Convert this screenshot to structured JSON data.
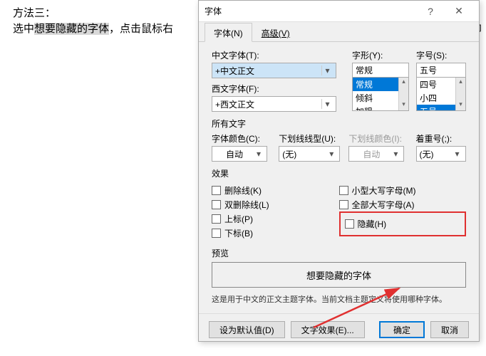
{
  "bg": {
    "line1": "方法三：",
    "line2_pre": "选中",
    "line2_hl": "想要隐藏的字体",
    "line2_post": "，点击鼠标右",
    "right": "能即"
  },
  "dialog": {
    "title": "字体",
    "tabs": {
      "font": "字体(N)",
      "advanced": "高级(V)"
    }
  },
  "fonts": {
    "cjk_label": "中文字体(T):",
    "cjk_value": "+中文正文",
    "latin_label": "西文字体(F):",
    "latin_value": "+西文正文",
    "style_label": "字形(Y):",
    "style_value": "常规",
    "style_options": [
      "常规",
      "倾斜",
      "加粗"
    ],
    "size_label": "字号(S):",
    "size_value": "五号",
    "size_options": [
      "四号",
      "小四",
      "五号"
    ]
  },
  "alltext": {
    "section": "所有文字",
    "color_label": "字体颜色(C):",
    "color_value": "自动",
    "underline_label": "下划线线型(U):",
    "underline_value": "(无)",
    "ulcolor_label": "下划线颜色(I):",
    "ulcolor_value": "自动",
    "emphasis_label": "着重号(;):",
    "emphasis_value": "(无)"
  },
  "effects": {
    "section": "效果",
    "strikethrough": "删除线(K)",
    "dblstrike": "双删除线(L)",
    "superscript": "上标(P)",
    "subscript": "下标(B)",
    "smallcaps": "小型大写字母(M)",
    "allcaps": "全部大写字母(A)",
    "hidden": "隐藏(H)"
  },
  "preview": {
    "section": "预览",
    "text": "想要隐藏的字体",
    "note": "这是用于中文的正文主题字体。当前文档主题定义将使用哪种字体。"
  },
  "buttons": {
    "defaults": "设为默认值(D)",
    "texteffects": "文字效果(E)...",
    "ok": "确定",
    "cancel": "取消"
  }
}
